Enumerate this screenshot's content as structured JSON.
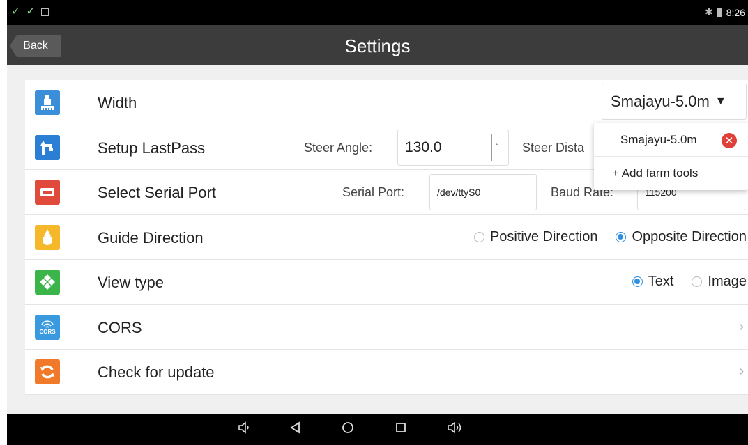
{
  "statusbar": {
    "left_icons": [
      "check-icon",
      "check-icon",
      "image-icon"
    ],
    "time": "8:26"
  },
  "header": {
    "back_label": "Back",
    "title": "Settings"
  },
  "rows": {
    "width": {
      "label": "Width",
      "dropdown_value": "Smajayu-5.0m"
    },
    "lastpass": {
      "label": "Setup LastPass",
      "steer_angle_label": "Steer Angle:",
      "steer_angle_value": "130.0",
      "steer_angle_unit": "°",
      "steer_distance_label": "Steer Dista"
    },
    "serial": {
      "label": "Select Serial Port",
      "port_label": "Serial Port:",
      "port_value": "/dev/ttyS0",
      "baud_label": "Baud Rate:",
      "baud_value": "115200"
    },
    "guide": {
      "label": "Guide Direction",
      "options": [
        "Positive Direction",
        "Opposite Direction"
      ],
      "selected": "Opposite Direction"
    },
    "view": {
      "label": "View type",
      "options": [
        "Text",
        "Image"
      ],
      "selected": "Text"
    },
    "cors": {
      "label": "CORS",
      "icon_text": "CORS"
    },
    "update": {
      "label": "Check for update"
    }
  },
  "popup": {
    "item_label": "Smajayu-5.0m",
    "add_label": "+ Add farm tools"
  },
  "colors": {
    "accent": "#2f8fe0",
    "width_icon": "#3a8fd8",
    "lastpass_icon": "#2a7fd4",
    "serial_icon": "#e04a3a",
    "guide_icon": "#f5b82a",
    "view_icon": "#3bb54a",
    "cors_icon": "#3a9ae0",
    "update_icon": "#f07a2a"
  }
}
